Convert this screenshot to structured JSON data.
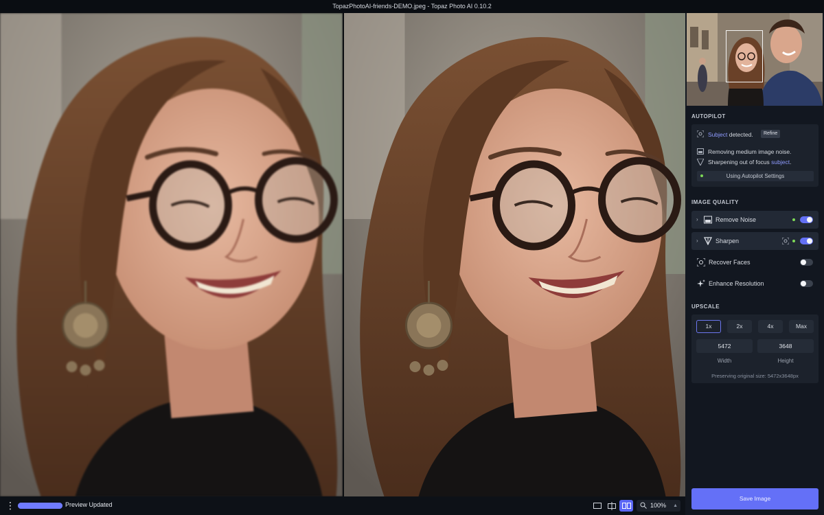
{
  "window": {
    "title": "TopazPhotoAI-friends-DEMO.jpeg - Topaz Photo AI 0.10.2"
  },
  "status": {
    "progress": 1.0,
    "text": "Preview Updated"
  },
  "view_controls": {
    "zoom": "100%",
    "active_mode": "side-by-side"
  },
  "autopilot": {
    "heading": "AUTOPILOT",
    "subject_word": "Subject",
    "detected_suffix": " detected.",
    "refine_label": "Refine",
    "noise_line": "Removing medium image noise.",
    "sharpen_prefix": "Sharpening out of focus ",
    "sharpen_subject": "subject",
    "sharpen_suffix": ".",
    "settings_button": "Using Autopilot Settings"
  },
  "image_quality": {
    "heading": "IMAGE QUALITY",
    "remove_noise": "Remove Noise",
    "sharpen": "Sharpen",
    "recover_faces": "Recover Faces",
    "enhance_resolution": "Enhance Resolution"
  },
  "upscale": {
    "heading": "UPSCALE",
    "options": [
      "1x",
      "2x",
      "4x",
      "Max"
    ],
    "selected": "1x",
    "width_value": "5472",
    "height_value": "3648",
    "width_label": "Width",
    "height_label": "Height",
    "note": "Preserving original size: 5472x3648px"
  },
  "save": {
    "label": "Save Image"
  },
  "colors": {
    "accent": "#6470f7",
    "active_dot": "#7ed957",
    "panel": "#121720"
  }
}
